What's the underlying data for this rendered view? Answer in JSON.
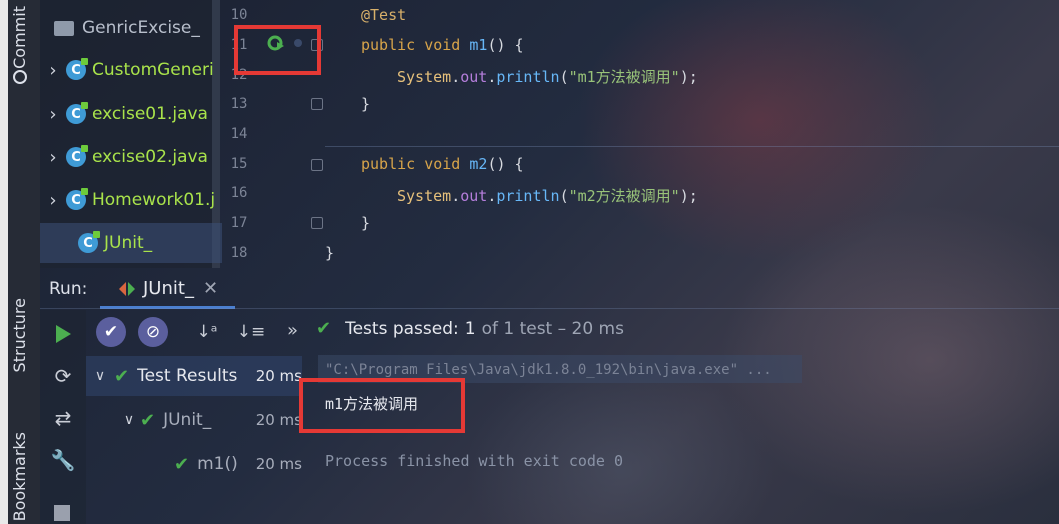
{
  "sidebar_tabs": {
    "commit": "Commit",
    "structure": "Structure",
    "bookmarks": "Bookmarks"
  },
  "project_tree": {
    "root": "GenricExcise_",
    "items": [
      {
        "name": "CustomGeneri",
        "color": "#a9e34b",
        "expanded": false
      },
      {
        "name": "excise01.java",
        "color": "#a9e34b",
        "expanded": false
      },
      {
        "name": "excise02.java",
        "color": "#a9e34b",
        "expanded": false
      },
      {
        "name": "Homework01.j",
        "color": "#a9e34b",
        "expanded": false
      },
      {
        "name": "JUnit_",
        "color": "#a9e34b",
        "expanded": false,
        "selected": true
      }
    ]
  },
  "editor": {
    "line_numbers": [
      "10",
      "11",
      "12",
      "13",
      "14",
      "15",
      "16",
      "17",
      "18"
    ],
    "lines": {
      "l10": {
        "annotation": "@Test"
      },
      "l11": {
        "kw1": "public",
        "kw2": "void",
        "method": "m1",
        "rest": "() {"
      },
      "l12": {
        "cls": "System",
        "dot1": ".",
        "field": "out",
        "dot2": ".",
        "method": "println",
        "open": "(",
        "str": "\"m1方法被调用\"",
        "close": ");"
      },
      "l13": {
        "text": "}"
      },
      "l15": {
        "kw1": "public",
        "kw2": "void",
        "method": "m2",
        "rest": "() {"
      },
      "l16": {
        "cls": "System",
        "dot1": ".",
        "field": "out",
        "dot2": ".",
        "method": "println",
        "open": "(",
        "str": "\"m2方法被调用\"",
        "close": ");"
      },
      "l17": {
        "text": "}"
      },
      "l18": {
        "text": "}"
      }
    },
    "gutter_icon": "run-test-icon"
  },
  "run_panel": {
    "label": "Run:",
    "tab_name": "JUnit_",
    "status_prefix": "Tests passed:",
    "status_count": "1",
    "status_rest": "of 1 test – 20 ms",
    "more": "»",
    "tree": [
      {
        "name": "Test Results",
        "time": "20 ms"
      },
      {
        "name": "JUnit_",
        "time": "20 ms"
      },
      {
        "name": "m1()",
        "time": "20 ms"
      }
    ],
    "console": {
      "cmd": "\"C:\\Program Files\\Java\\jdk1.8.0_192\\bin\\java.exe\" ...",
      "output": "m1方法被调用",
      "exit": "Process finished with exit code 0"
    }
  },
  "colors": {
    "accent_red": "#e53935",
    "pass_green": "#4caf50",
    "keyword": "#d7a44a",
    "string": "#98c379"
  }
}
